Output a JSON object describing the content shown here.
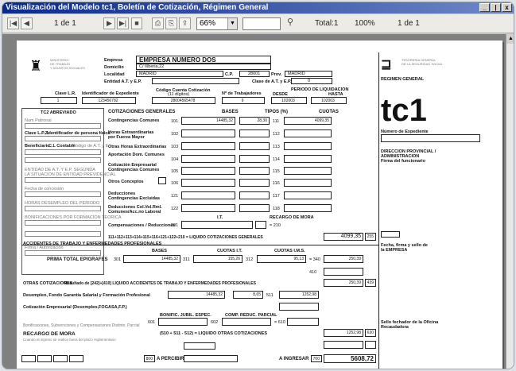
{
  "window": {
    "title": "Visualización del Modelo tc1, Boletín de Cotización, Régimen General",
    "minimize": "_",
    "restore": "|",
    "close": "x"
  },
  "toolbar": {
    "page_counter": "1 de 1",
    "zoom": "66%",
    "search_value": "",
    "total_label": "Total:1",
    "percent": "100%",
    "page_counter_right": "1 de 1"
  },
  "form": {
    "ministry": [
      "MINISTERIO",
      "DE TRABAJO",
      "Y ASUNTOS SOCIALES"
    ],
    "tgss": [
      "TESORERIA GENERAL",
      "DE LA SEGURIDAD SOCIAL"
    ],
    "regimen": "REGIMEN GENERAL",
    "tc1": "tc1",
    "labels": {
      "empresa": "Empresa",
      "domicilio": "Domicilio",
      "localidad": "Localidad",
      "entidad": "Entidad A.T. y E.P.",
      "cp": "C.P.",
      "prov": "Prov.",
      "clase_at": "Clase de A.T. y E.P.",
      "clave_lr": "Clave L.R.",
      "identificador": "Identificador de Expediente",
      "codigo_cuenta": "Código Cuenta Cotización",
      "codigo_cuenta_sub": "(11 dígitos)",
      "n_trabajadores": "Nº de Trabajadores",
      "periodo": "PERIODO DE LIQUIDACION",
      "desde": "DESDE",
      "hasta": "HASTA",
      "cotizaciones_generales": "COTIZACIONES GENERALES",
      "bases": "BASES",
      "tipos": "TIPOS (%)",
      "cuotas": "CUOTAS",
      "tc2_abreviado": "TC2 ABREVIADO",
      "n_expediente": "Número de Expediente",
      "direccion_provincial": [
        "DIRECCION PROVINCIAL /",
        "ADMINISTRACION",
        "Firma del funcionario"
      ],
      "fecha_firma": [
        "Fecha, firma y sello de",
        "la EMPRESA"
      ],
      "sello_oficina": [
        "Sello fechador de la Oficina",
        "Recaudadora"
      ],
      "accidentes": "ACCIDENTES DE TRABAJO Y ENFERMEDADES PROFESIONALES",
      "cuotas_it": "CUOTAS I.T.",
      "cuotas_ims": "CUOTAS I.M.S.",
      "prima_total": "PRIMA TOTAL EPIGRAFES",
      "otras_cotizaciones": "OTRAS COTIZACIONES",
      "otras_sub": "Resultado de [242]+[410] LIQUIDO ACCIDENTES DE TRABAJO Y ENFERMEDADES PROFESIONALES",
      "desempleo": "Desempleo, Fondo Garantía Salarial y Formación Profesional",
      "cotizacion_empresarial": "Cotización Empresarial (Desempleo,FOGASA,F.P.)",
      "recargo_mora": "RECARGO DE MORA",
      "recargo_sub": "Cuando el ingreso se realice fuera del plazo reglamentario",
      "a_percibir": "A PERCIBIR",
      "a_ingresar": "A INGRESAR",
      "bonificaciones": "Bonificaciones, Subvenciones y Compensaciones Distinto. Parcial",
      "bonif_header": "BONIFIC. JUBIL. ESPEC.",
      "comp_header": "COMP. REDUC. PARCIAL",
      "liquido_gral": "111+112+113+114+115+116+121+122+210 = LIQUIDO COTIZACIONES GENERALES",
      "liquido_otras": "(510 + 511 - 512) = LIQUIDO OTRAS COTIZACIONES",
      "compensaciones_reduc": "Compensaciones / Reducciones",
      "it": "I.T.",
      "recargo_label": "RECARGO DE MORA"
    },
    "values": {
      "empresa": "EMPRESA NUMERO DOS",
      "domicilio": "C/ Ilíberia,22",
      "localidad": "MADRID",
      "cp": "28001",
      "prov": "MADRID",
      "clase_at": "0",
      "clave_lr": "1",
      "identificador": "123456782",
      "ccc": "28004565478",
      "n_trab": "9",
      "desde": "102003",
      "hasta": "102003",
      "base_101": "14485,32",
      "tipo_101": "28,30",
      "cuota_111": "4099,35",
      "liquido_gral": "4099,35",
      "code_255": "255",
      "base_acc": "14485,32",
      "cuota_it": "155,26",
      "cuota_ims": "95,13",
      "total_acc": "250,39",
      "otras_total": "250,39",
      "code_439": "439",
      "base_510": "14485,32",
      "tipo_510": "8,65",
      "cuota_510": "1252,98",
      "liquido_otras": "1252,98",
      "code_630": "630",
      "recargo_total": "",
      "ingresar": "5608,72",
      "code_700": "700",
      "percibir": "800"
    },
    "codes": {
      "c101": "101",
      "c102": "102",
      "c103": "103",
      "c104": "104",
      "c105": "105",
      "c106": "106",
      "c121": "121",
      "c122": "122",
      "c201": "201",
      "c111": "111",
      "c112": "112",
      "c113": "113",
      "c114": "114",
      "c115": "115",
      "c116": "116",
      "c117": "117",
      "c118": "118",
      "c210": "= 210",
      "c301": "301",
      "c311": "311",
      "c312": "312",
      "c340": "= 340",
      "c410": "410",
      "c501": "501",
      "c511": "511",
      "c601": "601",
      "c602": "602",
      "c610": "= 610"
    },
    "concepts": [
      "Contingencias Comunes",
      "Horas Extraordinarias por Fuerza Mayor",
      "Otras Horas Extraordinarias",
      "Aportación Dom. Comunes",
      "Cotización Empresarial Contingencias Comunes",
      "Otros Conceptos",
      "Deducciones Contingencias Excluidas",
      "Deducciones Col.Vol.Rml. Comunes/Acc.no Laboral"
    ],
    "left_panel": [
      "Num Patronal",
      "Clave L.P.Z.",
      "Identificador de persona física",
      "Beneficiario",
      "C.L Contable",
      "Código de A.T. y E.",
      "ENTIDAD DE A.T. Y E.P. SEGUNDA",
      "LA SITUACION DE ENTIDAD PREVIDENCIAL",
      "Fecha de concesión",
      "HORAS DESEMPLEO DEL PERIODO",
      "BONIFICACIONES POR FORMACION TEORICA",
      "Firma / Autorización"
    ]
  }
}
